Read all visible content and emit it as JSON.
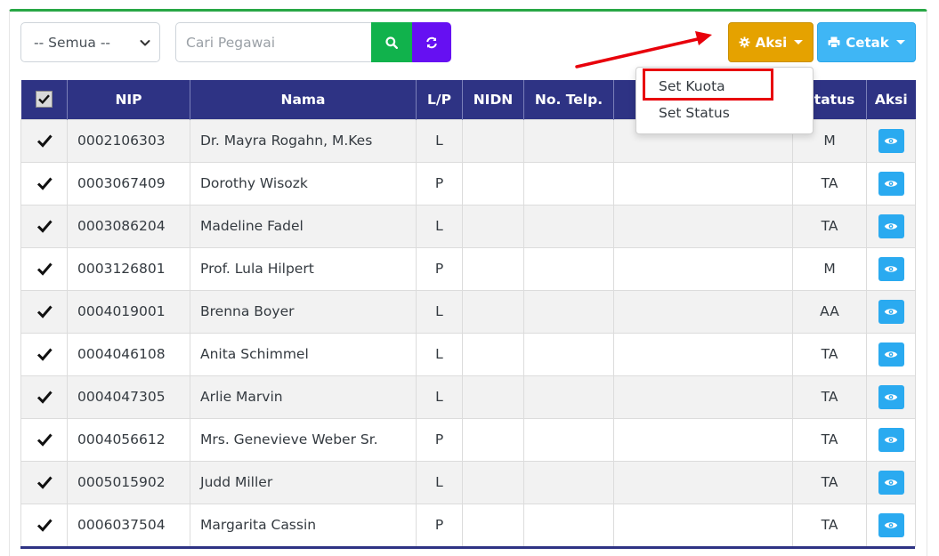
{
  "toolbar": {
    "filter_select_value": "-- Semua --",
    "search_placeholder": "Cari Pegawai",
    "aksi_label": "Aksi",
    "cetak_label": "Cetak"
  },
  "dropdown": {
    "items": [
      "Set Kuota",
      "Set Status"
    ]
  },
  "table": {
    "headers": [
      "NIP",
      "Nama",
      "L/P",
      "NIDN",
      "No. Telp.",
      "Status",
      "Aksi"
    ],
    "rows": [
      {
        "nip": "0002106303",
        "nama": "Dr. Mayra Rogahn, M.Kes",
        "lp": "L",
        "status": "M"
      },
      {
        "nip": "0003067409",
        "nama": "Dorothy Wisozk",
        "lp": "P",
        "status": "TA"
      },
      {
        "nip": "0003086204",
        "nama": "Madeline Fadel",
        "lp": "L",
        "status": "TA"
      },
      {
        "nip": "0003126801",
        "nama": "Prof. Lula Hilpert",
        "lp": "P",
        "status": "M"
      },
      {
        "nip": "0004019001",
        "nama": "Brenna Boyer",
        "lp": "L",
        "status": "AA"
      },
      {
        "nip": "0004046108",
        "nama": "Anita Schimmel",
        "lp": "L",
        "status": "TA"
      },
      {
        "nip": "0004047305",
        "nama": "Arlie Marvin",
        "lp": "L",
        "status": "TA"
      },
      {
        "nip": "0004056612",
        "nama": "Mrs. Genevieve Weber Sr.",
        "lp": "P",
        "status": "TA"
      },
      {
        "nip": "0005015902",
        "nama": "Judd Miller",
        "lp": "L",
        "status": "TA"
      },
      {
        "nip": "0006037504",
        "nama": "Margarita Cassin",
        "lp": "P",
        "status": "TA"
      }
    ]
  },
  "colors": {
    "header_bg": "#2e3384",
    "aksi_button": "#e5a200",
    "cetak_button": "#3fb6f5",
    "search_button": "#11b24c",
    "refresh_button": "#6610f2",
    "annotation_red": "#e8000b"
  },
  "icons": [
    "chevron-down-icon",
    "search-icon",
    "refresh-icon",
    "gear-icon",
    "print-icon",
    "checkbox-icon",
    "eye-icon"
  ]
}
